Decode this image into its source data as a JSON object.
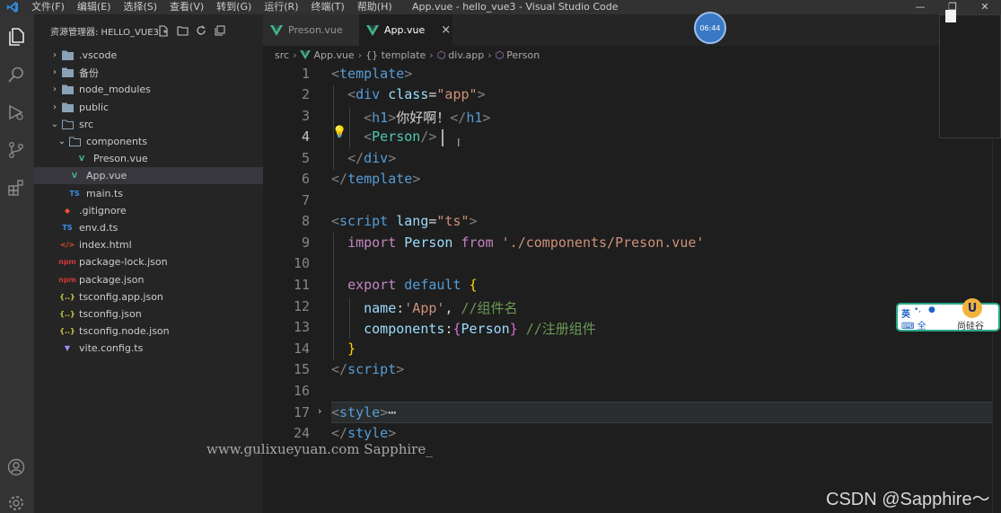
{
  "titlebar": {
    "menu": [
      "文件(F)",
      "编辑(E)",
      "选择(S)",
      "查看(V)",
      "转到(G)",
      "运行(R)",
      "终端(T)",
      "帮助(H)"
    ],
    "title": "App.vue - hello_vue3 - Visual Studio Code",
    "window_controls": [
      "—",
      "❐",
      "✕"
    ]
  },
  "activity_bar": [
    "explorer-icon",
    "search-icon",
    "run-debug-icon",
    "source-control-icon",
    "extensions-icon",
    "account-icon",
    "settings-icon"
  ],
  "sidebar": {
    "header": "资源管理器: HELLO_VUE3",
    "tree": [
      {
        "label": ".vscode",
        "kind": "folder",
        "depth": 0,
        "open": false
      },
      {
        "label": "备份",
        "kind": "folder",
        "depth": 0,
        "open": false
      },
      {
        "label": "node_modules",
        "kind": "folder",
        "depth": 0,
        "open": false
      },
      {
        "label": "public",
        "kind": "folder",
        "depth": 0,
        "open": false
      },
      {
        "label": "src",
        "kind": "folder",
        "depth": 0,
        "open": true
      },
      {
        "label": "components",
        "kind": "folder",
        "depth": 1,
        "open": true
      },
      {
        "label": "Preson.vue",
        "kind": "vue",
        "depth": 2
      },
      {
        "label": "App.vue",
        "kind": "vue",
        "depth": 1,
        "active": true
      },
      {
        "label": "main.ts",
        "kind": "ts",
        "depth": 1
      },
      {
        "label": ".gitignore",
        "kind": "git",
        "depth": 0
      },
      {
        "label": "env.d.ts",
        "kind": "ts",
        "depth": 0
      },
      {
        "label": "index.html",
        "kind": "html",
        "depth": 0
      },
      {
        "label": "package-lock.json",
        "kind": "npm",
        "depth": 0
      },
      {
        "label": "package.json",
        "kind": "npm",
        "depth": 0
      },
      {
        "label": "tsconfig.app.json",
        "kind": "json",
        "depth": 0
      },
      {
        "label": "tsconfig.json",
        "kind": "json",
        "depth": 0
      },
      {
        "label": "tsconfig.node.json",
        "kind": "json",
        "depth": 0
      },
      {
        "label": "vite.config.ts",
        "kind": "vite",
        "depth": 0
      }
    ]
  },
  "tabs": [
    {
      "label": "Preson.vue",
      "active": false
    },
    {
      "label": "App.vue",
      "active": true,
      "close": "×"
    }
  ],
  "clock": "06:44",
  "breadcrumb": [
    "src",
    "App.vue",
    "{} template",
    "div.app",
    "Person"
  ],
  "editor": {
    "line_numbers": [
      "1",
      "2",
      "3",
      "4",
      "5",
      "6",
      "7",
      "8",
      "9",
      "10",
      "11",
      "12",
      "13",
      "14",
      "15",
      "16",
      "17",
      "24"
    ],
    "current_line": "4",
    "fold_marker": "⋯"
  },
  "ime": {
    "top_left": "英",
    "icons": "⌨ 全",
    "brand": "尚硅谷",
    "badge": "U"
  },
  "watermark": "www.gulixueyuan.com Sapphire_",
  "csdn": "CSDN @Sapphire～",
  "colors": {
    "accent": "#007acc",
    "tag": "#569cd6",
    "string": "#ce9178",
    "keyword": "#c586c0",
    "type": "#4ec9b0",
    "comment": "#6a9955"
  }
}
